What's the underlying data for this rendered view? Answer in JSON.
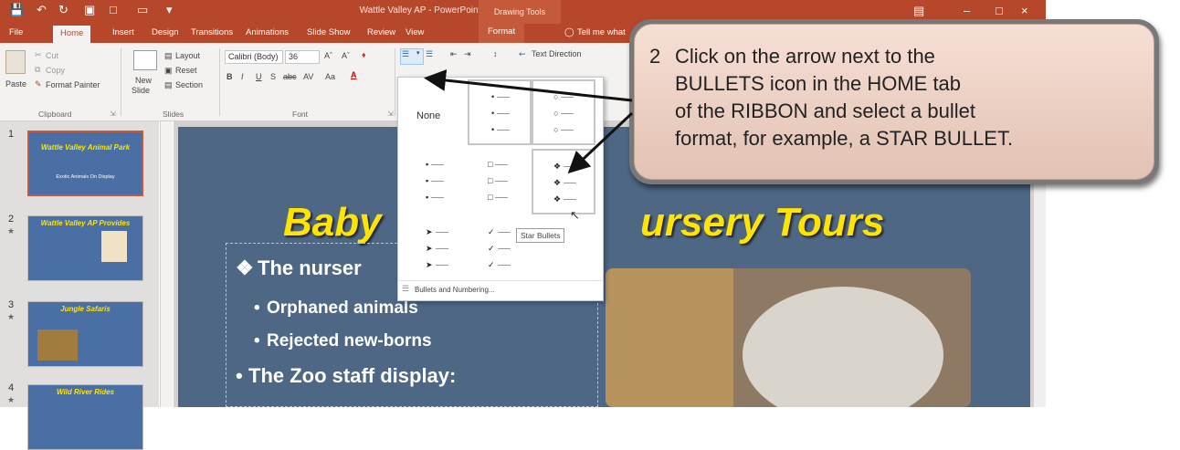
{
  "titlebar": {
    "title": "Wattle Valley AP - PowerPoint",
    "context_tab_group": "Drawing Tools"
  },
  "tabs": [
    {
      "label": "File"
    },
    {
      "label": "Home"
    },
    {
      "label": "Insert"
    },
    {
      "label": "Design"
    },
    {
      "label": "Transitions"
    },
    {
      "label": "Animations"
    },
    {
      "label": "Slide Show"
    },
    {
      "label": "Review"
    },
    {
      "label": "View"
    },
    {
      "label": "Format"
    },
    {
      "label": "Tell me what"
    }
  ],
  "ribbon": {
    "clipboard": {
      "paste": "Paste",
      "cut": "Cut",
      "copy": "Copy",
      "format_painter": "Format Painter",
      "group": "Clipboard"
    },
    "slides": {
      "new_slide": "New",
      "new_slide2": "Slide",
      "layout": "Layout",
      "reset": "Reset",
      "section": "Section",
      "group": "Slides"
    },
    "font": {
      "name": "Calibri (Body)",
      "size": "36",
      "group": "Font"
    },
    "paragraph": {
      "text_direction": "Text Direction"
    }
  },
  "thumbnails": [
    {
      "num": "1",
      "title": "Wattle Valley Animal Park",
      "sub": "Exotic Animals On Display"
    },
    {
      "num": "2",
      "title": "Wattle Valley AP Provides"
    },
    {
      "num": "3",
      "title": "Jungle Safaris"
    },
    {
      "num": "4",
      "title": "Wild River Rides"
    }
  ],
  "slide": {
    "title": "Baby",
    "title_right": "ursery Tours",
    "bullets": [
      {
        "text": "The nurser"
      },
      {
        "text": "Orphaned animals"
      },
      {
        "text": "Rejected new-borns"
      },
      {
        "text": "The Zoo staff display:"
      }
    ]
  },
  "bullets_menu": {
    "none_label": "None",
    "footer": "Bullets and Numbering...",
    "tooltip": "Star Bullets"
  },
  "callout": {
    "number": "2",
    "lines": [
      "Click on the arrow next to the",
      "BULLETS icon in the HOME tab",
      "of the RIBBON and select a bullet",
      "format, for example, a STAR BULLET."
    ]
  }
}
